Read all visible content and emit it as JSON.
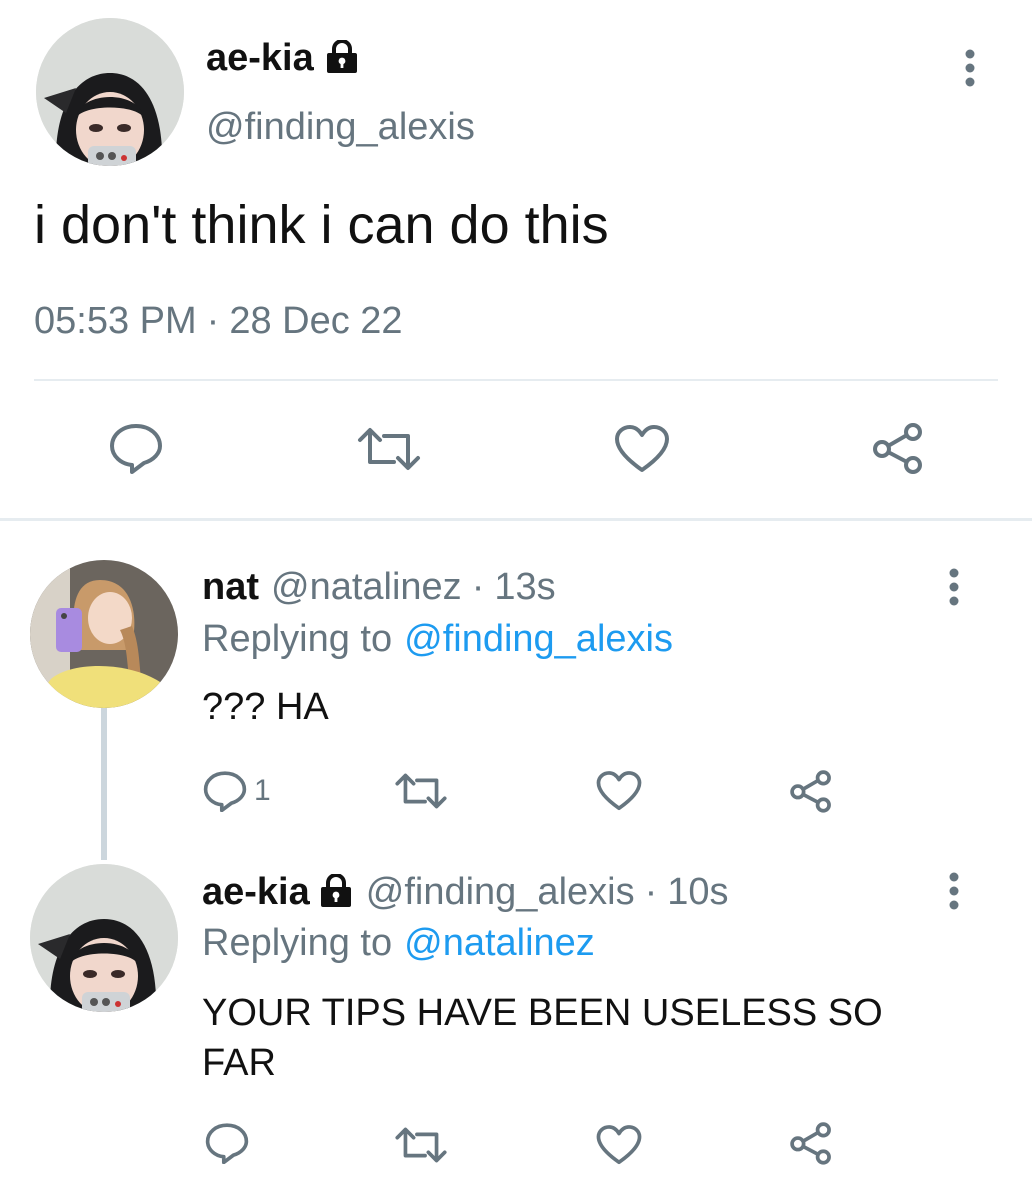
{
  "main_tweet": {
    "display_name": "ae-kia",
    "handle": "@finding_alexis",
    "text": "i don't think i can do this",
    "time": "05:53 PM",
    "separator": "·",
    "date": "28 Dec 22",
    "avatar_icon": "avatar-girl-phone",
    "lock_icon": "lock-icon"
  },
  "replies": [
    {
      "display_name": "nat",
      "handle": "@natalinez",
      "separator": "·",
      "age": "13s",
      "replying_prefix": "Replying to",
      "replying_to": "@finding_alexis",
      "text": "??? HA",
      "reply_count": "1"
    },
    {
      "display_name": "ae-kia",
      "handle": "@finding_alexis",
      "separator": "·",
      "age": "10s",
      "replying_prefix": "Replying to",
      "replying_to": "@natalinez",
      "text_line1": "YOUR TIPS HAVE BEEN USELESS SO",
      "text_line2": "FAR",
      "reply_count": ""
    }
  ],
  "colors": {
    "text": "#111111",
    "secondary": "#66757f",
    "link": "#1d9bf0",
    "divider": "#e6ecf0"
  }
}
